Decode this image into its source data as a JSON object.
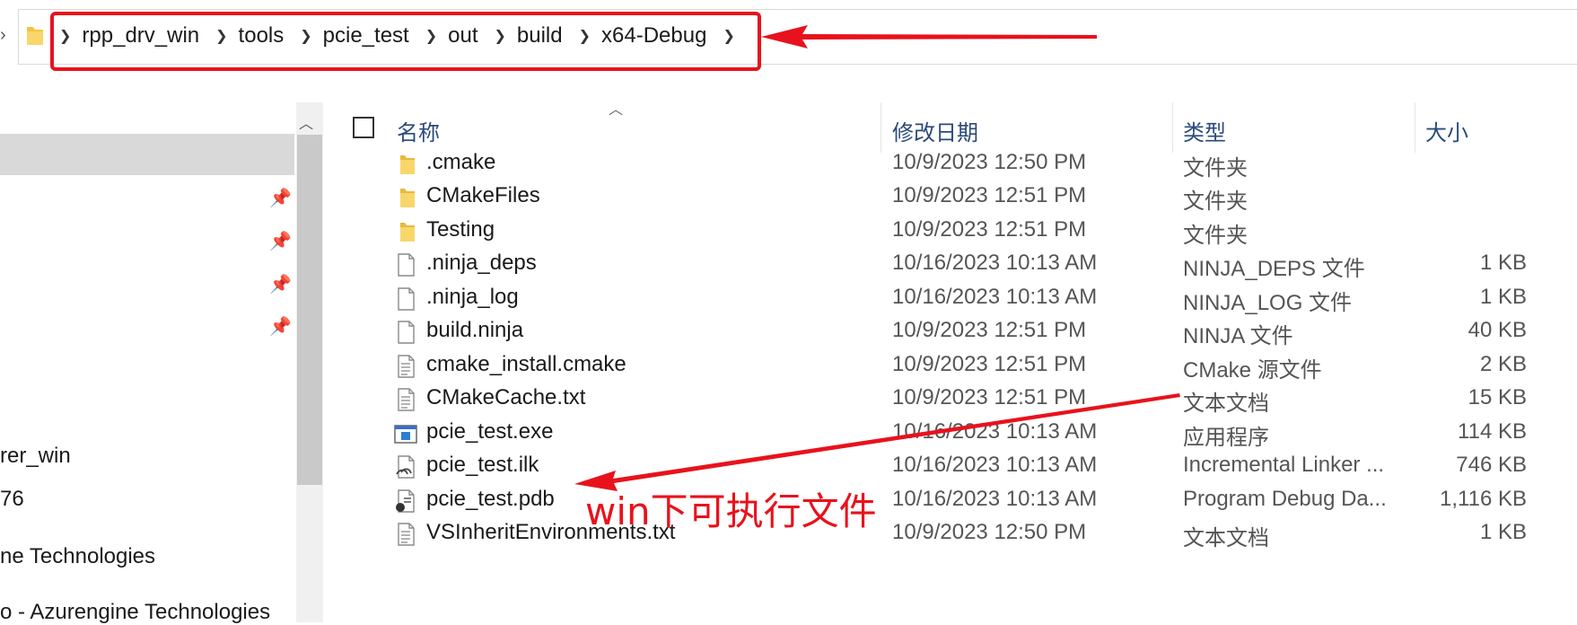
{
  "address": {
    "crumbs": [
      "rpp_drv_win",
      "tools",
      "pcie_test",
      "out",
      "build",
      "x64-Debug"
    ]
  },
  "nav": {
    "items": [
      "rer_win",
      "76",
      "ne Technologies",
      "o - Azurengine Technologies"
    ]
  },
  "columns": {
    "name": "名称",
    "date": "修改日期",
    "type": "类型",
    "size": "大小"
  },
  "files": [
    {
      "name": ".cmake",
      "date": "10/9/2023 12:50 PM",
      "type": "文件夹",
      "size": "",
      "icon": "folder-icon"
    },
    {
      "name": "CMakeFiles",
      "date": "10/9/2023 12:51 PM",
      "type": "文件夹",
      "size": "",
      "icon": "folder-icon"
    },
    {
      "name": "Testing",
      "date": "10/9/2023 12:51 PM",
      "type": "文件夹",
      "size": "",
      "icon": "folder-icon"
    },
    {
      "name": ".ninja_deps",
      "date": "10/16/2023 10:13 AM",
      "type": "NINJA_DEPS 文件",
      "size": "1 KB",
      "icon": "file-icon"
    },
    {
      "name": ".ninja_log",
      "date": "10/16/2023 10:13 AM",
      "type": "NINJA_LOG 文件",
      "size": "1 KB",
      "icon": "file-icon"
    },
    {
      "name": "build.ninja",
      "date": "10/9/2023 12:51 PM",
      "type": "NINJA 文件",
      "size": "40 KB",
      "icon": "file-icon"
    },
    {
      "name": "cmake_install.cmake",
      "date": "10/9/2023 12:51 PM",
      "type": "CMake 源文件",
      "size": "2 KB",
      "icon": "text-file-icon"
    },
    {
      "name": "CMakeCache.txt",
      "date": "10/9/2023 12:51 PM",
      "type": "文本文档",
      "size": "15 KB",
      "icon": "text-file-icon"
    },
    {
      "name": "pcie_test.exe",
      "date": "10/16/2023 10:13 AM",
      "type": "应用程序",
      "size": "114 KB",
      "icon": "exe-icon"
    },
    {
      "name": "pcie_test.ilk",
      "date": "10/16/2023 10:13 AM",
      "type": "Incremental Linker ...",
      "size": "746 KB",
      "icon": "linker-file-icon"
    },
    {
      "name": "pcie_test.pdb",
      "date": "10/16/2023 10:13 AM",
      "type": "Program Debug Da...",
      "size": "1,116 KB",
      "icon": "debug-file-icon"
    },
    {
      "name": "VSInheritEnvironments.txt",
      "date": "10/9/2023 12:50 PM",
      "type": "文本文档",
      "size": "1 KB",
      "icon": "text-file-icon"
    }
  ],
  "annotation": {
    "label": "win下可执行文件",
    "color": "#e8121c"
  }
}
